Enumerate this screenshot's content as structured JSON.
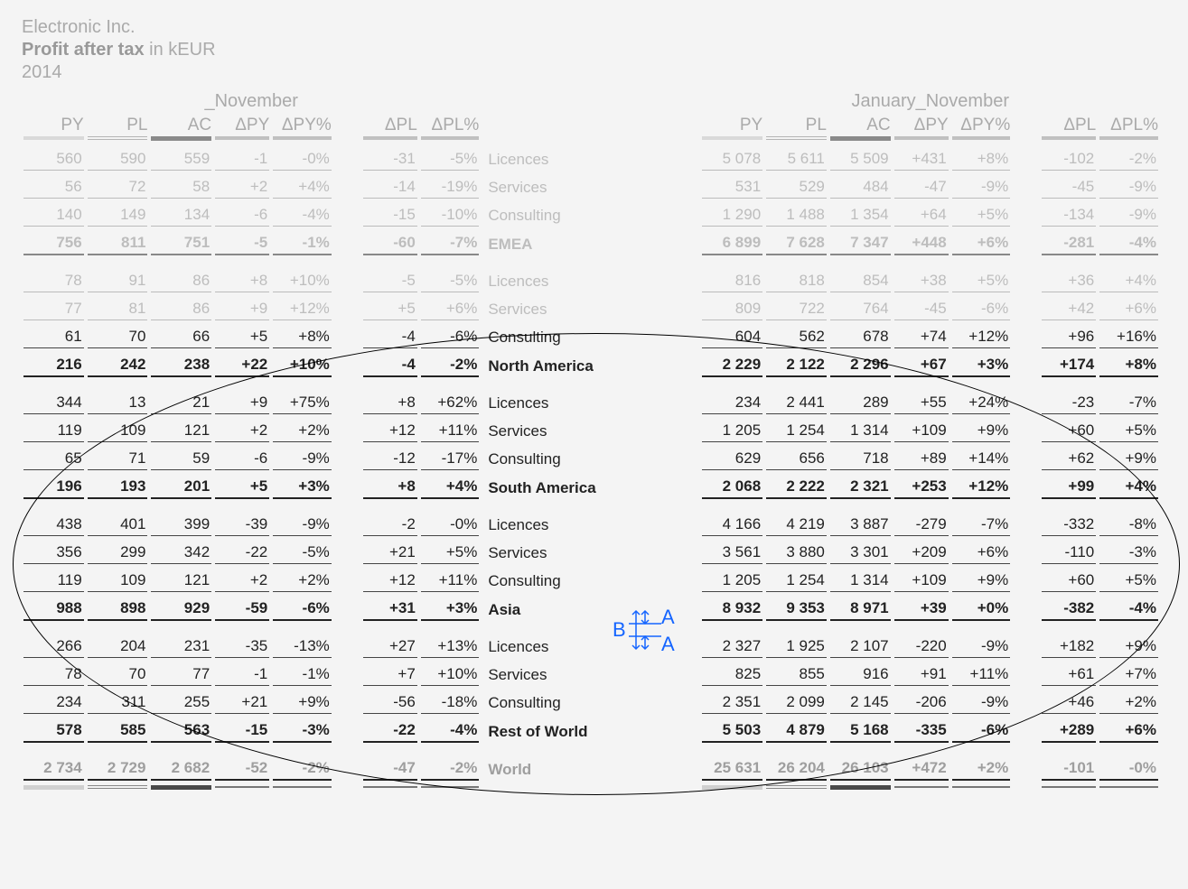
{
  "header": {
    "company": "Electronic Inc.",
    "metric": "Profit after tax",
    "unit": "in kEUR",
    "year": "2014"
  },
  "periods": {
    "left": "_November",
    "right": "January_November"
  },
  "column_labels": {
    "PY": "PY",
    "PL": "PL",
    "AC": "AC",
    "dPY": "ΔPY",
    "dPYp": "ΔPY%",
    "dPL": "ΔPL",
    "dPLp": "ΔPL%"
  },
  "annotation": {
    "A_top": "A",
    "A_bot": "A",
    "B": "B"
  },
  "chart_data": {
    "type": "table",
    "title": "Profit after tax in kEUR — 2014",
    "periods": [
      "_November",
      "January_November"
    ],
    "columns": [
      "PY",
      "PL",
      "AC",
      "ΔPY",
      "ΔPY%",
      "ΔPL",
      "ΔPL%"
    ],
    "regions": [
      {
        "name": "EMEA",
        "rows": [
          {
            "label": "Licences",
            "nov": {
              "PY": 560,
              "PL": 590,
              "AC": 559,
              "dPY": -1,
              "dPYp": "-0%",
              "dPL": -31,
              "dPLp": "-5%"
            },
            "ytd": {
              "PY": 5078,
              "PL": 5611,
              "AC": 5509,
              "dPY": 431,
              "dPYp": "+8%",
              "dPL": -102,
              "dPLp": "-2%"
            }
          },
          {
            "label": "Services",
            "nov": {
              "PY": 56,
              "PL": 72,
              "AC": 58,
              "dPY": 2,
              "dPYp": "+4%",
              "dPL": -14,
              "dPLp": "-19%"
            },
            "ytd": {
              "PY": 531,
              "PL": 529,
              "AC": 484,
              "dPY": -47,
              "dPYp": "-9%",
              "dPL": -45,
              "dPLp": "-9%"
            }
          },
          {
            "label": "Consulting",
            "nov": {
              "PY": 140,
              "PL": 149,
              "AC": 134,
              "dPY": -6,
              "dPYp": "-4%",
              "dPL": -15,
              "dPLp": "-10%"
            },
            "ytd": {
              "PY": 1290,
              "PL": 1488,
              "AC": 1354,
              "dPY": 64,
              "dPYp": "+5%",
              "dPL": -134,
              "dPLp": "-9%"
            }
          }
        ],
        "subtotal": {
          "label": "EMEA",
          "nov": {
            "PY": 756,
            "PL": 811,
            "AC": 751,
            "dPY": -5,
            "dPYp": "-1%",
            "dPL": -60,
            "dPLp": "-7%"
          },
          "ytd": {
            "PY": 6899,
            "PL": 7628,
            "AC": 7347,
            "dPY": 448,
            "dPYp": "+6%",
            "dPL": -281,
            "dPLp": "-4%"
          }
        }
      },
      {
        "name": "North America",
        "rows": [
          {
            "label": "Licences",
            "nov": {
              "PY": 78,
              "PL": 91,
              "AC": 86,
              "dPY": 8,
              "dPYp": "+10%",
              "dPL": -5,
              "dPLp": "-5%"
            },
            "ytd": {
              "PY": 816,
              "PL": 818,
              "AC": 854,
              "dPY": 38,
              "dPYp": "+5%",
              "dPL": 36,
              "dPLp": "+4%"
            }
          },
          {
            "label": "Services",
            "nov": {
              "PY": 77,
              "PL": 81,
              "AC": 86,
              "dPY": 9,
              "dPYp": "+12%",
              "dPL": 5,
              "dPLp": "+6%"
            },
            "ytd": {
              "PY": 809,
              "PL": 722,
              "AC": 764,
              "dPY": -45,
              "dPYp": "-6%",
              "dPL": 42,
              "dPLp": "+6%"
            }
          },
          {
            "label": "Consulting",
            "nov": {
              "PY": 61,
              "PL": 70,
              "AC": 66,
              "dPY": 5,
              "dPYp": "+8%",
              "dPL": -4,
              "dPLp": "-6%"
            },
            "ytd": {
              "PY": 604,
              "PL": 562,
              "AC": 678,
              "dPY": 74,
              "dPYp": "+12%",
              "dPL": 96,
              "dPLp": "+16%"
            }
          }
        ],
        "subtotal": {
          "label": "North America",
          "nov": {
            "PY": 216,
            "PL": 242,
            "AC": 238,
            "dPY": 22,
            "dPYp": "+10%",
            "dPL": -4,
            "dPLp": "-2%"
          },
          "ytd": {
            "PY": 2229,
            "PL": 2122,
            "AC": 2296,
            "dPY": 67,
            "dPYp": "+3%",
            "dPL": 174,
            "dPLp": "+8%"
          }
        }
      },
      {
        "name": "South America",
        "rows": [
          {
            "label": "Licences",
            "nov": {
              "PY": 344,
              "PL": 13,
              "AC": 21,
              "dPY": 9,
              "dPYp": "+75%",
              "dPL": 8,
              "dPLp": "+62%"
            },
            "ytd": {
              "PY": 234,
              "PL": 2441,
              "AC": 289,
              "dPY": 55,
              "dPYp": "+24%",
              "dPL": -23,
              "dPLp": "-7%"
            }
          },
          {
            "label": "Services",
            "nov": {
              "PY": 119,
              "PL": 109,
              "AC": 121,
              "dPY": 2,
              "dPYp": "+2%",
              "dPL": 12,
              "dPLp": "+11%"
            },
            "ytd": {
              "PY": 1205,
              "PL": 1254,
              "AC": 1314,
              "dPY": 109,
              "dPYp": "+9%",
              "dPL": 60,
              "dPLp": "+5%"
            }
          },
          {
            "label": "Consulting",
            "nov": {
              "PY": 65,
              "PL": 71,
              "AC": 59,
              "dPY": -6,
              "dPYp": "-9%",
              "dPL": -12,
              "dPLp": "-17%"
            },
            "ytd": {
              "PY": 629,
              "PL": 656,
              "AC": 718,
              "dPY": 89,
              "dPYp": "+14%",
              "dPL": 62,
              "dPLp": "+9%"
            }
          }
        ],
        "subtotal": {
          "label": "South America",
          "nov": {
            "PY": 196,
            "PL": 193,
            "AC": 201,
            "dPY": 5,
            "dPYp": "+3%",
            "dPL": 8,
            "dPLp": "+4%"
          },
          "ytd": {
            "PY": 2068,
            "PL": 2222,
            "AC": 2321,
            "dPY": 253,
            "dPYp": "+12%",
            "dPL": 99,
            "dPLp": "+4%"
          }
        }
      },
      {
        "name": "Asia",
        "rows": [
          {
            "label": "Licences",
            "nov": {
              "PY": 438,
              "PL": 401,
              "AC": 399,
              "dPY": -39,
              "dPYp": "-9%",
              "dPL": -2,
              "dPLp": "-0%"
            },
            "ytd": {
              "PY": 4166,
              "PL": 4219,
              "AC": 3887,
              "dPY": -279,
              "dPYp": "-7%",
              "dPL": -332,
              "dPLp": "-8%"
            }
          },
          {
            "label": "Services",
            "nov": {
              "PY": 356,
              "PL": 299,
              "AC": 342,
              "dPY": -22,
              "dPYp": "-5%",
              "dPL": 21,
              "dPLp": "+5%"
            },
            "ytd": {
              "PY": 3561,
              "PL": 3880,
              "AC": 3301,
              "dPY": 209,
              "dPYp": "+6%",
              "dPL": -110,
              "dPLp": "-3%"
            }
          },
          {
            "label": "Consulting",
            "nov": {
              "PY": 119,
              "PL": 109,
              "AC": 121,
              "dPY": 2,
              "dPYp": "+2%",
              "dPL": 12,
              "dPLp": "+11%"
            },
            "ytd": {
              "PY": 1205,
              "PL": 1254,
              "AC": 1314,
              "dPY": 109,
              "dPYp": "+9%",
              "dPL": 60,
              "dPLp": "+5%"
            }
          }
        ],
        "subtotal": {
          "label": "Asia",
          "nov": {
            "PY": 988,
            "PL": 898,
            "AC": 929,
            "dPY": -59,
            "dPYp": "-6%",
            "dPL": 31,
            "dPLp": "+3%"
          },
          "ytd": {
            "PY": 8932,
            "PL": 9353,
            "AC": 8971,
            "dPY": 39,
            "dPYp": "+0%",
            "dPL": -382,
            "dPLp": "-4%"
          }
        }
      },
      {
        "name": "Rest of World",
        "rows": [
          {
            "label": "Licences",
            "nov": {
              "PY": 266,
              "PL": 204,
              "AC": 231,
              "dPY": -35,
              "dPYp": "-13%",
              "dPL": 27,
              "dPLp": "+13%"
            },
            "ytd": {
              "PY": 2327,
              "PL": 1925,
              "AC": 2107,
              "dPY": -220,
              "dPYp": "-9%",
              "dPL": 182,
              "dPLp": "+9%"
            }
          },
          {
            "label": "Services",
            "nov": {
              "PY": 78,
              "PL": 70,
              "AC": 77,
              "dPY": -1,
              "dPYp": "-1%",
              "dPL": 7,
              "dPLp": "+10%"
            },
            "ytd": {
              "PY": 825,
              "PL": 855,
              "AC": 916,
              "dPY": 91,
              "dPYp": "+11%",
              "dPL": 61,
              "dPLp": "+7%"
            }
          },
          {
            "label": "Consulting",
            "nov": {
              "PY": 234,
              "PL": 311,
              "AC": 255,
              "dPY": 21,
              "dPYp": "+9%",
              "dPL": -56,
              "dPLp": "-18%"
            },
            "ytd": {
              "PY": 2351,
              "PL": 2099,
              "AC": 2145,
              "dPY": -206,
              "dPYp": "-9%",
              "dPL": 46,
              "dPLp": "+2%"
            }
          }
        ],
        "subtotal": {
          "label": "Rest of World",
          "nov": {
            "PY": 578,
            "PL": 585,
            "AC": 563,
            "dPY": -15,
            "dPYp": "-3%",
            "dPL": -22,
            "dPLp": "-4%"
          },
          "ytd": {
            "PY": 5503,
            "PL": 4879,
            "AC": 5168,
            "dPY": -335,
            "dPYp": "-6%",
            "dPL": 289,
            "dPLp": "+6%"
          }
        }
      }
    ],
    "world": {
      "label": "World",
      "nov": {
        "PY": 2734,
        "PL": 2729,
        "AC": 2682,
        "dPY": -52,
        "dPYp": "-2%",
        "dPL": -47,
        "dPLp": "-2%"
      },
      "ytd": {
        "PY": 25631,
        "PL": 26204,
        "AC": 26103,
        "dPY": 472,
        "dPYp": "+2%",
        "dPL": -101,
        "dPLp": "-0%"
      }
    }
  }
}
